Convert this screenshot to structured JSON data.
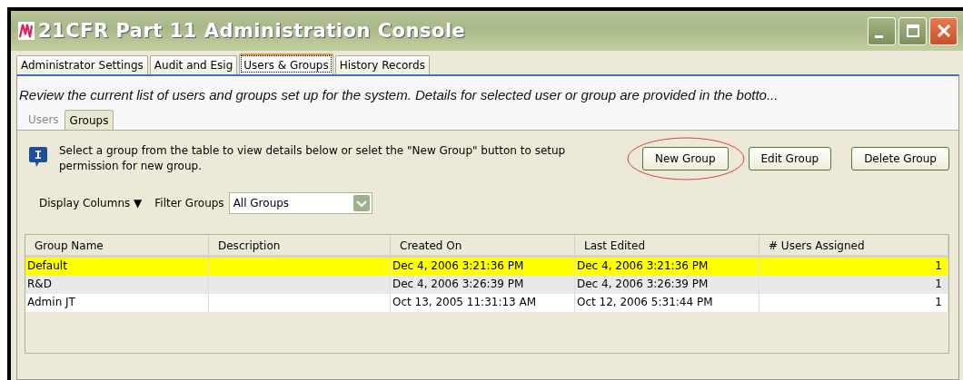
{
  "window": {
    "title": "21CFR Part 11 Administration Console"
  },
  "tabs": [
    {
      "label": "Administrator Settings",
      "selected": false
    },
    {
      "label": "Audit and Esig",
      "selected": false
    },
    {
      "label": "Users & Groups",
      "selected": true
    },
    {
      "label": "History Records",
      "selected": false
    }
  ],
  "description": "Review the current list of users and groups set up for the system. Details for selected user or group are provided in the botto...",
  "subtabs": [
    {
      "label": "Users",
      "selected": false
    },
    {
      "label": "Groups",
      "selected": true
    }
  ],
  "info_text": "Select a group from the table to view details below or selet the \"New Group\" button to setup permission for new group.",
  "buttons": [
    {
      "label": "New Group",
      "highlighted": true
    },
    {
      "label": "Edit Group",
      "highlighted": false
    },
    {
      "label": "Delete Group",
      "highlighted": false
    }
  ],
  "display_columns": {
    "label": "Display Columns",
    "caret": "▼"
  },
  "filter": {
    "label": "Filter Groups",
    "value": "All Groups"
  },
  "table": {
    "columns": [
      "Group Name",
      "Description",
      "Created On",
      "Last Edited",
      "# Users Assigned"
    ],
    "rows": [
      {
        "cells": [
          "Default",
          "",
          "Dec 4, 2006 3:21:36 PM",
          "Dec 4, 2006 3:21:36 PM",
          "1"
        ],
        "selected": true
      },
      {
        "cells": [
          "R&D",
          "",
          "Dec 4, 2006 3:26:39 PM",
          "Dec 4, 2006 3:26:39 PM",
          "1"
        ],
        "selected": false
      },
      {
        "cells": [
          "Admin JT",
          "",
          "Oct 13, 2005 11:31:13 AM",
          "Oct 12, 2006 5:31:44 PM",
          "1"
        ],
        "selected": false
      }
    ]
  }
}
